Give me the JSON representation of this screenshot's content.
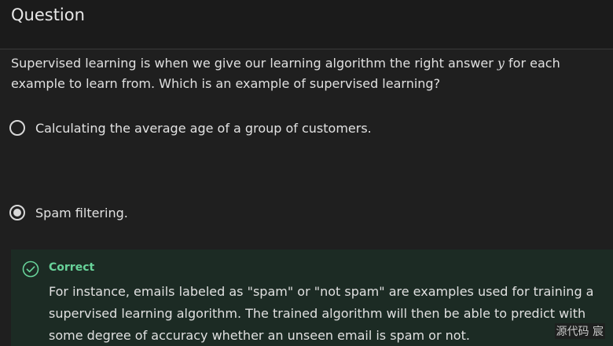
{
  "header": {
    "title": "Question"
  },
  "question": {
    "text_before": "Supervised learning is when we give our learning algorithm the right answer ",
    "variable": "y",
    "text_after": " for each example to learn from.  Which is an example of supervised learning?"
  },
  "options": [
    {
      "label": "Calculating the average age of a group of customers.",
      "selected": false
    },
    {
      "label": "Spam filtering.",
      "selected": true
    }
  ],
  "feedback": {
    "status": "Correct",
    "text": "For instance, emails labeled as \"spam\" or \"not spam\" are examples used for training a supervised learning algorithm. The trained algorithm will then be able to predict with some degree of accuracy whether an unseen email is spam or not.",
    "colors": {
      "accent": "#68d39a",
      "background": "#1c2b24"
    },
    "icon": "check-circle-icon"
  },
  "watermark": "源代码  宸"
}
